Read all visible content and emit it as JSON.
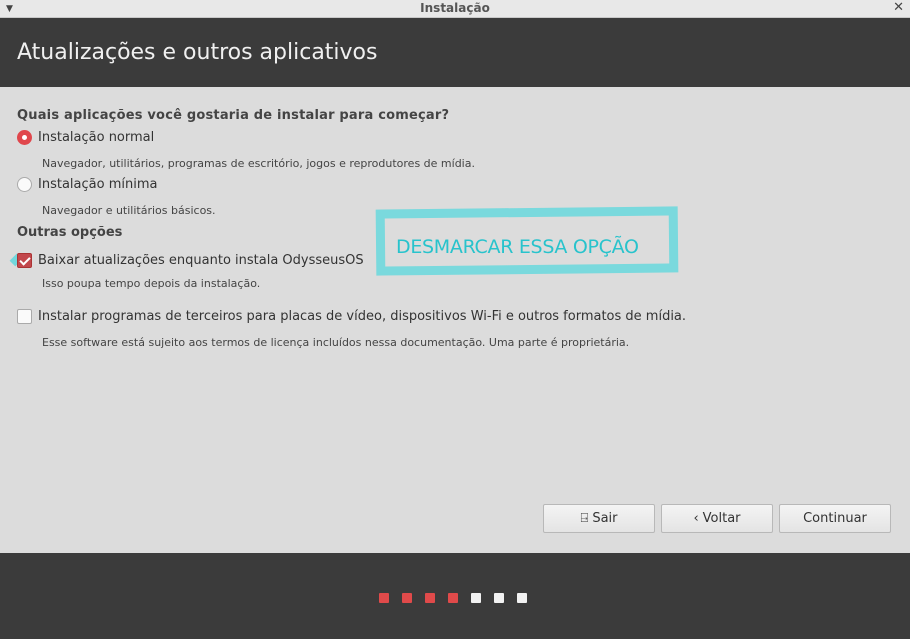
{
  "window": {
    "title": "Instalação"
  },
  "header": {
    "title": "Atualizações e outros aplicativos"
  },
  "install": {
    "question": "Quais aplicações você gostaria de instalar para começar?",
    "normal_label": "Instalação normal",
    "normal_desc": "Navegador, utilitários, programas de escritório, jogos e reprodutores de mídia.",
    "normal_selected": true,
    "minimal_label": "Instalação mínima",
    "minimal_desc": "Navegador e utilitários básicos.",
    "minimal_selected": false
  },
  "other": {
    "title": "Outras opções",
    "updates_label": "Baixar atualizações enquanto instala OdysseusOS",
    "updates_desc": "Isso poupa tempo depois da instalação.",
    "updates_checked": true,
    "thirdparty_label": "Instalar programas de terceiros para placas de vídeo, dispositivos Wi-Fi e outros formatos de mídia.",
    "thirdparty_desc": "Esse software está sujeito aos termos de licença incluídos nessa documentação. Uma parte é proprietária.",
    "thirdparty_checked": false
  },
  "annotation": {
    "text": "DESMARCAR ESSA OPÇÃO",
    "color": "#28c3cc"
  },
  "buttons": {
    "quit": "Sair",
    "back": "Voltar",
    "continue": "Continuar"
  },
  "progress": {
    "completed_steps": 4,
    "total_steps": 7
  },
  "colors": {
    "accent": "#e0474c",
    "header_bg": "#3b3b3b",
    "content_bg": "#dcdcdc"
  }
}
